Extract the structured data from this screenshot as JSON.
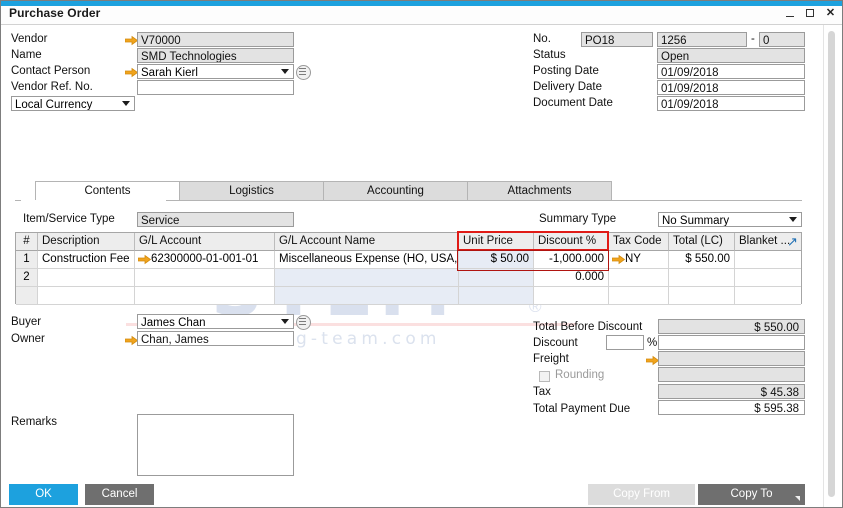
{
  "window": {
    "title": "Purchase Order",
    "minimize": "–",
    "maximize": "□",
    "close": "✕"
  },
  "header_left": {
    "vendor_label": "Vendor",
    "vendor_value": "V70000",
    "name_label": "Name",
    "name_value": "SMD Technologies",
    "contact_label": "Contact Person",
    "contact_value": "Sarah Kierl",
    "vendor_ref_label": "Vendor Ref. No.",
    "vendor_ref_value": "",
    "currency_value": "Local Currency"
  },
  "header_right": {
    "no_label": "No.",
    "no_series": "PO18",
    "no_value": "1256",
    "no_dash": "-",
    "no_suffix": "0",
    "status_label": "Status",
    "status_value": "Open",
    "posting_date_label": "Posting Date",
    "posting_date_value": "01/09/2018",
    "delivery_date_label": "Delivery Date",
    "delivery_date_value": "01/09/2018",
    "document_date_label": "Document Date",
    "document_date_value": "01/09/2018"
  },
  "tabs": [
    {
      "label": "Contents",
      "active": true
    },
    {
      "label": "Logistics",
      "active": false
    },
    {
      "label": "Accounting",
      "active": false
    },
    {
      "label": "Attachments",
      "active": false
    }
  ],
  "contents": {
    "item_service_type_label": "Item/Service Type",
    "item_service_type_value": "Service",
    "summary_type_label": "Summary Type",
    "summary_type_value": "No Summary"
  },
  "grid": {
    "columns": [
      "#",
      "Description",
      "G/L Account",
      "G/L Account Name",
      "Unit Price",
      "Discount %",
      "Tax Code",
      "Total (LC)",
      "Blanket ..."
    ],
    "rows": [
      {
        "num": "1",
        "description": "Construction Fee",
        "gl_account": "62300000-01-001-01",
        "gl_account_name": "Miscellaneous Expense (HO, USA, GA)",
        "unit_price": "$ 50.00",
        "discount_pct": "-1,000.000",
        "tax_code": "NY",
        "total_lc": "$ 550.00",
        "blanket": ""
      },
      {
        "num": "2",
        "description": "",
        "gl_account": "",
        "gl_account_name": "",
        "unit_price": "",
        "discount_pct": "0.000",
        "tax_code": "",
        "total_lc": "",
        "blanket": ""
      }
    ],
    "highlight_color": "#e01b16"
  },
  "footer_left": {
    "buyer_label": "Buyer",
    "buyer_value": "James Chan",
    "owner_label": "Owner",
    "owner_value": "Chan, James",
    "remarks_label": "Remarks",
    "remarks_value": ""
  },
  "totals": {
    "total_before_discount_label": "Total Before Discount",
    "total_before_discount_value": "$ 550.00",
    "discount_label": "Discount",
    "discount_pct_value": "",
    "discount_pct_sign": "%",
    "discount_amount_value": "",
    "freight_label": "Freight",
    "freight_value": "",
    "rounding_label": "Rounding",
    "rounding_value": "",
    "tax_label": "Tax",
    "tax_value": "$ 45.38",
    "total_payment_due_label": "Total Payment Due",
    "total_payment_due_value": "$ 595.38"
  },
  "buttons": {
    "ok": "OK",
    "cancel": "Cancel",
    "copy_from": "Copy From",
    "copy_to": "Copy To"
  },
  "watermark": {
    "main": "STEM",
    "registered": "®",
    "sub": "www.sterling-team.com"
  }
}
